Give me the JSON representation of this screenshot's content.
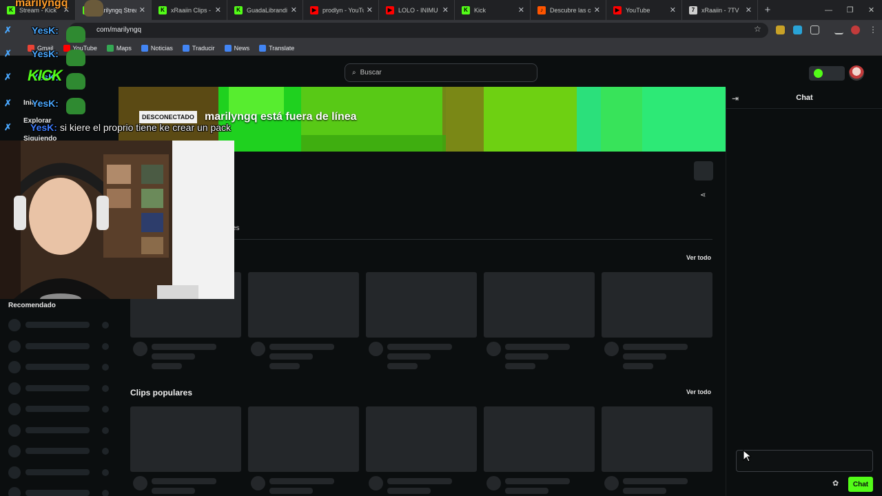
{
  "browser": {
    "tabs": [
      {
        "title": "Stream - Kick",
        "favicon_color": "#53fc18",
        "favicon_glyph": "K"
      },
      {
        "title": "marilyngq Stream",
        "favicon_color": "#53fc18",
        "favicon_glyph": "K",
        "active": true
      },
      {
        "title": "xRaaiin Clips - W",
        "favicon_color": "#53fc18",
        "favicon_glyph": "K"
      },
      {
        "title": "GuadaLibrandi St",
        "favicon_color": "#53fc18",
        "favicon_glyph": "K"
      },
      {
        "title": "prodlyn - YouTub",
        "favicon_color": "#ff0000",
        "favicon_glyph": "▶"
      },
      {
        "title": "LOLO - INIMU (Vi",
        "favicon_color": "#ff0000",
        "favicon_glyph": "▶"
      },
      {
        "title": "Kick",
        "favicon_color": "#53fc18",
        "favicon_glyph": "K"
      },
      {
        "title": "Descubre las canc",
        "favicon_color": "#ff5500",
        "favicon_glyph": "♪"
      },
      {
        "title": "YouTube",
        "favicon_color": "#ff0000",
        "favicon_glyph": "▶"
      },
      {
        "title": "xRaaiin - 7TV",
        "favicon_color": "#cfcfcf",
        "favicon_glyph": "7"
      }
    ],
    "new_tab": "+",
    "url": "com/marilyngq",
    "bookmarks": [
      {
        "label": "Gmail",
        "color": "#ea4335"
      },
      {
        "label": "YouTube",
        "color": "#ff0000"
      },
      {
        "label": "Maps",
        "color": "#34a853"
      },
      {
        "label": "Noticias",
        "color": "#4285f4"
      },
      {
        "label": "Traducir",
        "color": "#4285f4"
      },
      {
        "label": "News",
        "color": "#4285f4"
      },
      {
        "label": "Translate",
        "color": "#4285f4"
      }
    ]
  },
  "kick": {
    "accent": "#53fc18",
    "search_placeholder": "Buscar",
    "sidebar": {
      "inicio": "Inicio",
      "explorar": "Explorar",
      "siguiendo": "Siguiendo",
      "recomendado": "Recomendado"
    },
    "offline_badge": "DESCONECTADO",
    "offline_message": "marilyngq está fuera de línea",
    "tab_fragment": "es",
    "chat": {
      "title": "Chat",
      "send_label": "Chat"
    },
    "sections": {
      "first": {
        "see_all": "Ver todo"
      },
      "clips": {
        "title": "Clips populares",
        "see_all": "Ver todo"
      }
    }
  },
  "overlay": {
    "streamer": "marilyngq",
    "chatter": "YesK:",
    "message": "si kiere el proprio tiene ke crear un pack",
    "kick_logo": "KICK"
  }
}
